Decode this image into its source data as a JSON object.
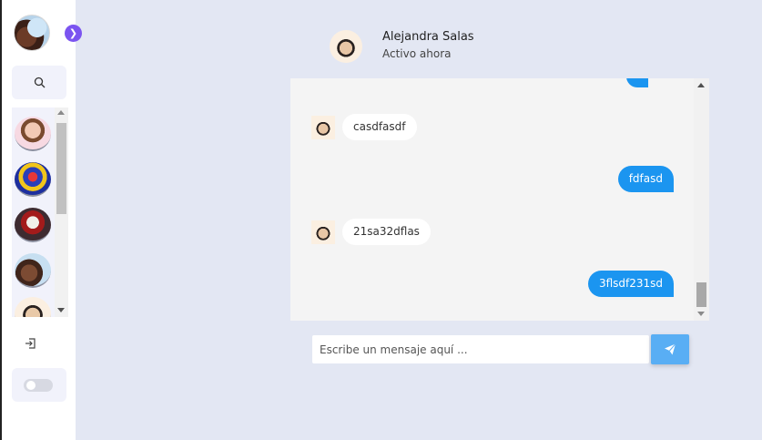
{
  "contact": {
    "name": "Alejandra Salas",
    "status": "Activo ahora"
  },
  "messages": [
    {
      "type": "received",
      "text": "casdfasdf"
    },
    {
      "type": "sent",
      "text": "fdfasd"
    },
    {
      "type": "received",
      "text": "21sa32dflas"
    },
    {
      "type": "sent",
      "text": "3flsdf231sd"
    }
  ],
  "composer": {
    "placeholder": "Escribe un mensaje aquí ...",
    "value": ""
  },
  "colors": {
    "background": "#e3e7f3",
    "sent_bubble": "#1b95f0",
    "send_button": "#59aef4",
    "expand_button": "#7b54f0"
  },
  "icons": {
    "expand": "chevron-right-icon",
    "search": "search-icon",
    "logout": "logout-icon",
    "send": "paper-plane-icon"
  }
}
